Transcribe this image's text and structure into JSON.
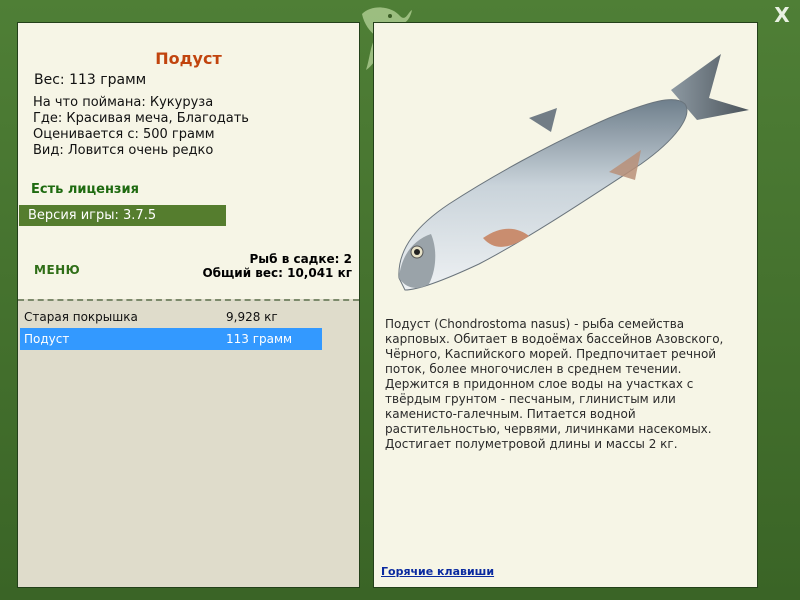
{
  "fish": {
    "name": "Подуст",
    "weight_line": "Вес: 113 грамм",
    "caught_on": "На что поймана: Кукуруза",
    "where": "Где: Красивая меча, Благодать",
    "valued_from": "Оценивается с: 500 грамм",
    "species_rarity": "Вид: Ловится очень редко",
    "description": "Подуст (Chondrostoma nasus) - рыба семейства карповых. Обитает в водоёмах бассейнов Азовского, Чёрного, Каспийского морей. Предпочитает речной поток, более многочислен в среднем течении. Держится в придонном слое воды на участках с твёрдым грунтом - песчаным, глинистым или каменисто-галечным. Питается водной растительностью, червями, личинками насекомых. Достигает полуметровой длины и массы 2 кг."
  },
  "license_label": "Есть лицензия",
  "version_label": "Версия игры: 3.7.5",
  "menu_label": "МЕНЮ",
  "stats": {
    "fish_count": "Рыб в садке: 2",
    "total_weight": "Общий вес: 10,041 кг"
  },
  "catch_list": [
    {
      "name": "Старая покрышка",
      "weight": "9,928 кг",
      "selected": false
    },
    {
      "name": "Подуст",
      "weight": "113 грамм",
      "selected": true
    }
  ],
  "hotkeys_label": "Горячие клавиши",
  "close_label": "X",
  "colors": {
    "frame_green": "#4f7f36",
    "panel_bg": "#f6f5e6",
    "title_orange": "#c1440e",
    "selection_blue": "#3399ff",
    "version_bar": "#557d2e"
  },
  "icons": {
    "close": "close-icon",
    "decoration": "fish-emblem-icon",
    "fish_picture": "fish-image"
  }
}
